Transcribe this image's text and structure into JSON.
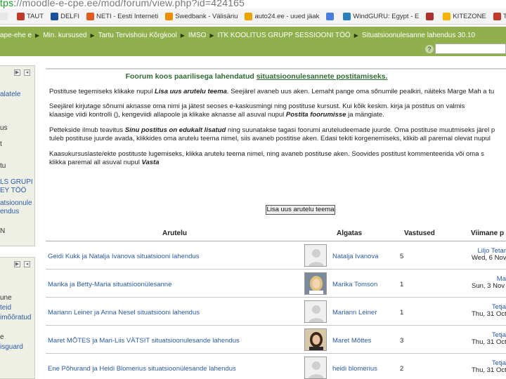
{
  "browser": {
    "url_scheme": "tps",
    "url_rest": "://moodle-e-cpe.ee/mod/forum/view.php?id=424165",
    "bookmarks": [
      {
        "label": "",
        "color": "#e7e7e7"
      },
      {
        "label": "TAUT",
        "color": "#c0392b"
      },
      {
        "label": "DELFI",
        "color": "#1a4fa0"
      },
      {
        "label": "NETI - Eesti Interneti",
        "color": "#e25b1e"
      },
      {
        "label": "Swedbank - Välisäriu",
        "color": "#f08c00"
      },
      {
        "label": "auto24.ee - uued jäak",
        "color": "#e9a400"
      },
      {
        "label": "",
        "color": "#4a7de0"
      },
      {
        "label": "WindGURU: Egypt - E",
        "color": "#2a7fc0"
      },
      {
        "label": "",
        "color": "#b03030"
      },
      {
        "label": "KITEZONE",
        "color": "#f4b400"
      },
      {
        "label": "Trip.ee |",
        "color": "#c0392b"
      }
    ]
  },
  "breadcrumb": [
    "ape-ehe e",
    "Min. kursused",
    "Tartu Tervishoiu Kõrgkool",
    "IMSO",
    "ITK KOOLITUS GRUPP SESSIOONI TÖÖ",
    "Situatsioonulesanne lahendus 30.10"
  ],
  "sidebar1": {
    "items": [
      {
        "text": "alatele",
        "link": true
      },
      {
        "text": "us",
        "link": false
      },
      {
        "text": "t",
        "link": false
      },
      {
        "text": "tu",
        "link": false
      },
      {
        "text": "LS GRUPI",
        "link": true
      },
      {
        "text": "EY TÖÖ",
        "link": true
      },
      {
        "text": "atsioonule",
        "link": true
      },
      {
        "text": "endus",
        "link": true
      },
      {
        "text": "N",
        "link": false
      }
    ]
  },
  "sidebar2": {
    "items": [
      {
        "text": "une",
        "link": false
      },
      {
        "text": "teid",
        "link": true
      },
      {
        "text": "imõõratud",
        "link": true
      },
      {
        "text": "e",
        "link": false
      },
      {
        "text": "isguard",
        "link": true
      }
    ]
  },
  "intro": {
    "title_pre": "Foorum koos paarilisega lahendatud",
    "title_hl": "situatsioonulesannete postitamiseks.",
    "p1_pre": "Postituse tegemiseks klikake nupul",
    "p1_em": "Lisa uus arutelu teema",
    "p1_post": ". Seejärel avaneb uus aken. Lemaht pange oma sõnumile pealkiri, näiteks Marge Mah a tu",
    "p2_line1": "Seejärel kirjutage sõnumi aknasse oma nimi ja jätest seoses e-kaskusmingi ning postituse kursust. Kui kõik keskm. kirja ja postitus on valmis",
    "p2_line2_pre": "klaasige viidi kontrolli (), kengeviidi allapoole ja klikake aknasse all asuval nupul",
    "p2_line2_em": "Postita foorumisse",
    "p2_line2_post": "ja mängiate.",
    "p3_line1_pre": "Pettekside ilmub teavitus",
    "p3_line1_em": "Sinu postitus on edukalt lisatud",
    "p3_line1_post": "ning suunatakse tagasi foorumi aruteludeemade juurde. Oma postituse muutmiseks järel p",
    "p3_line2": "tuleb postituse juurde avada, klikkides oma arutelu teema nimel, siis avaneb postitise aken. Edasi tekiti korgenemiseks, klikib all paremal olevat nupul",
    "p4_line1": "Kaasukursuslaste/ekte postituste lugemiseks, klikka arutelu teema nimel, ning avaneb postituse aken. Soovides postitust kommenteerida või oma s",
    "p4_line2_pre": "klikka paremal all asuval nupul",
    "p4_line2_em": "Vasta"
  },
  "add_topic_button": "Lisa uus arutelu teema",
  "table": {
    "headers": {
      "topic": "Arutelu",
      "author": "Algatas",
      "replies": "Vastused",
      "last": "Viimane p"
    },
    "rows": [
      {
        "topic": "Geidi Kukk ja Natalja Ivanova situatsiooni lahendus",
        "author": "Natalja Ivanova",
        "replies": "5",
        "last1": "Liljo Tetar",
        "last2": "Wed, 6 Nov",
        "avatar": "blank"
      },
      {
        "topic": "Marika ja Betty-Maria situatsioonülesanne",
        "author": "Marika Tomson",
        "replies": "1",
        "last1": "Ma",
        "last2": "Sun, 3 Nov",
        "avatar": "photo-blonde"
      },
      {
        "topic": "Mariann Leiner ja Anna Nesel situatsiooni lahendus",
        "author": "Mariann Leiner",
        "replies": "1",
        "last1": "Tetja",
        "last2": "Thu, 31 Oct",
        "avatar": "blank"
      },
      {
        "topic": "Maret MÕTES ja Mari-Liis VÄTSIT situatsioonulesande lahendus",
        "author": "Maret Mõttes",
        "replies": "3",
        "last1": "Tetja",
        "last2": "Thu, 31 Oct",
        "avatar": "photo-dark"
      },
      {
        "topic": "Ene Põhurand ja Heidi Blomerius situatsioonülesande lahendus",
        "author": "heidi blomerius",
        "replies": "2",
        "last1": "Tetja",
        "last2": "Thu, 31 Oct",
        "avatar": "blank"
      }
    ]
  },
  "colors": {
    "accent_green": "#8fb04c",
    "link_blue": "#2b5aa8",
    "title_green": "#2e6b31"
  }
}
